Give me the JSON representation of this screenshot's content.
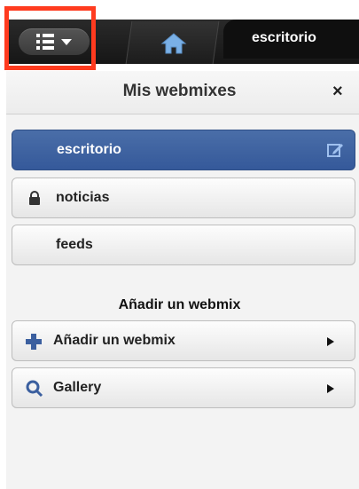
{
  "topbar": {
    "menu_button": {
      "icon": "list-icon",
      "caret": "chevron-down-icon"
    },
    "home_tab": {
      "icon": "home-icon"
    },
    "active_tab_label": "escritorio"
  },
  "panel": {
    "title": "Mis webmixes",
    "close_label": "×",
    "webmixes": [
      {
        "label": "escritorio",
        "icon": "edit-icon",
        "active": true
      },
      {
        "label": "noticias",
        "icon": "lock-icon",
        "active": false
      },
      {
        "label": "feeds",
        "active": false
      }
    ],
    "add_section": {
      "heading": "Añadir un webmix",
      "items": [
        {
          "label": "Añadir un webmix",
          "icon": "plus-icon"
        },
        {
          "label": "Gallery",
          "icon": "search-icon"
        }
      ]
    }
  },
  "colors": {
    "active_item": "#3f63a3",
    "highlight": "#ff3b1f",
    "topbar": "#1c1c1c"
  }
}
